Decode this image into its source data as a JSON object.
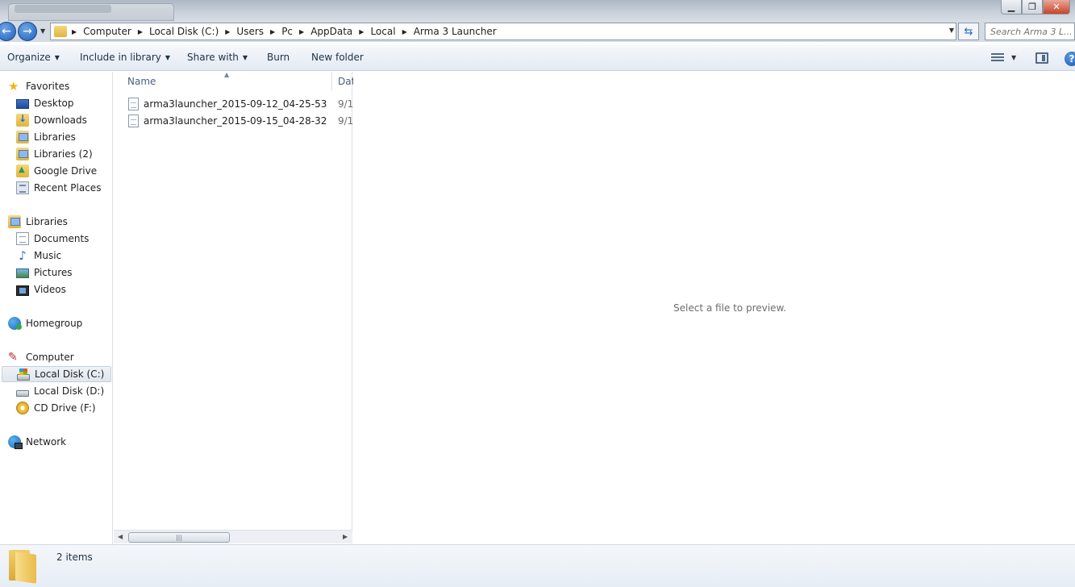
{
  "window": {
    "controls": {
      "minimize": "▁",
      "maximize": "❐",
      "close": "✕"
    }
  },
  "nav_buttons": {
    "back": "←",
    "forward": "→"
  },
  "address": {
    "crumbs": [
      "Computer",
      "Local Disk (C:)",
      "Users",
      "Pc",
      "AppData",
      "Local",
      "Arma 3 Launcher"
    ]
  },
  "search": {
    "placeholder": "Search Arma 3 L..."
  },
  "toolbar": {
    "organize": "Organize",
    "include_in_library": "Include in library",
    "share_with": "Share with",
    "burn": "Burn",
    "new_folder": "New folder",
    "help": "?"
  },
  "sidebar": {
    "favorites": {
      "header": "Favorites",
      "items": [
        "Desktop",
        "Downloads",
        "Libraries",
        "Libraries (2)",
        "Google Drive",
        "Recent Places"
      ]
    },
    "libraries": {
      "header": "Libraries",
      "items": [
        "Documents",
        "Music",
        "Pictures",
        "Videos"
      ]
    },
    "homegroup": {
      "header": "Homegroup"
    },
    "computer": {
      "header": "Computer",
      "items": [
        "Local Disk (C:)",
        "Local Disk (D:)",
        "CD Drive (F:)"
      ],
      "selected": "Local Disk (C:)"
    },
    "network": {
      "header": "Network"
    }
  },
  "file_list": {
    "columns": [
      "Name",
      "Dat"
    ],
    "rows": [
      {
        "name": "arma3launcher_2015-09-12_04-25-53",
        "date": "9/1"
      },
      {
        "name": "arma3launcher_2015-09-15_04-28-32",
        "date": "9/1"
      }
    ],
    "scroll_thumb_glyph": "|||"
  },
  "preview": {
    "message": "Select a file to preview."
  },
  "details": {
    "item_count": "2 items"
  },
  "colors": {
    "accent": "#1f5fb8",
    "folder": "#e0b440",
    "selection": "#dfe6ee"
  }
}
